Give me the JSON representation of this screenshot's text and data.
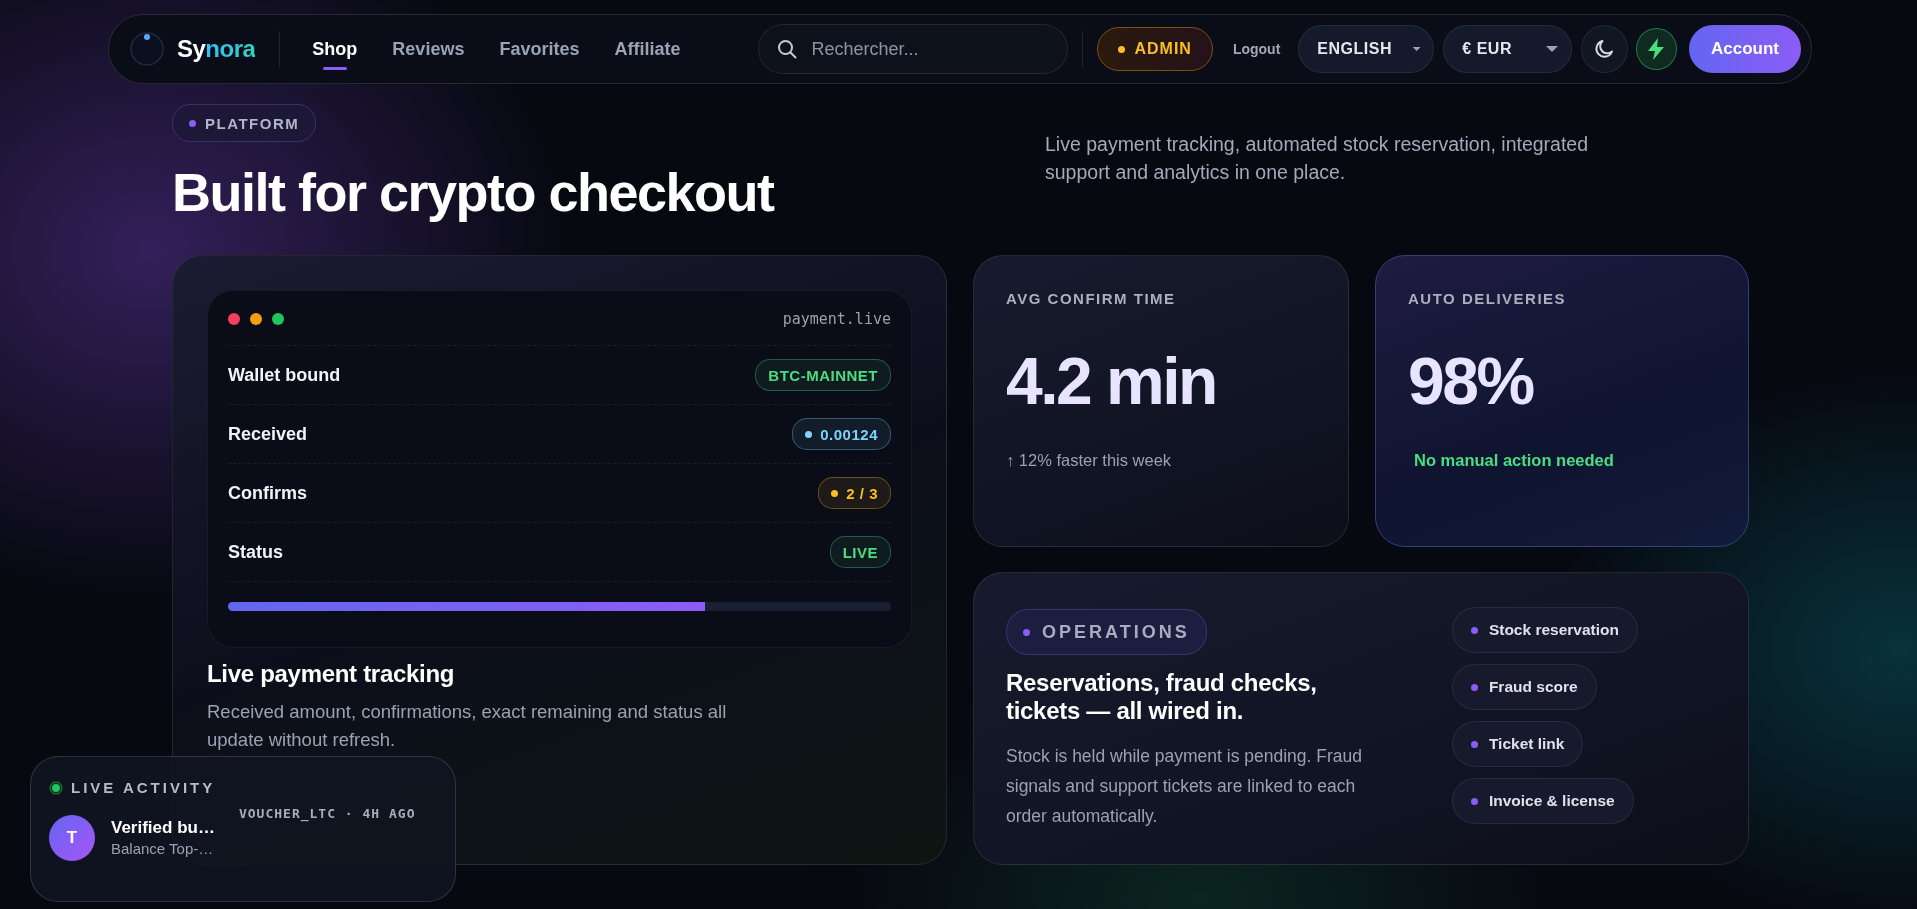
{
  "nav": {
    "logo": {
      "first": "Sy",
      "second": "nora"
    },
    "links": [
      {
        "label": "Shop",
        "selected": true
      },
      {
        "label": "Reviews",
        "selected": false
      },
      {
        "label": "Favorites",
        "selected": false
      },
      {
        "label": "Affiliate",
        "selected": false
      }
    ],
    "search": {
      "placeholder": "Rechercher..."
    },
    "admin_badge": "ADMIN",
    "logout": "Logout",
    "language": "ENGLISH",
    "currency": "€ EUR",
    "account": "Account"
  },
  "hero": {
    "badge": "PLATFORM",
    "title": "Built for crypto checkout",
    "description": "Live payment tracking, automated stock reservation, integrated support and analytics in one place."
  },
  "payment_card": {
    "window_title": "payment.live",
    "rows": [
      {
        "label": "Wallet bound",
        "value": "BTC-MAINNET",
        "color": "#4ade80",
        "dot": false
      },
      {
        "label": "Received",
        "value": "0.00124",
        "color": "#7dd3fc",
        "dot": true
      },
      {
        "label": "Confirms",
        "value": "2 / 3",
        "color": "#fbbf24",
        "dot": true
      },
      {
        "label": "Status",
        "value": "LIVE",
        "color": "#4ade80",
        "dot": false
      }
    ],
    "progress": {
      "level": 0.72
    },
    "title": "Live payment tracking",
    "description": "Received amount, confirmations, exact remaining and status all update without refresh."
  },
  "stats": [
    {
      "label": "AVG CONFIRM TIME",
      "value": "4.2 min",
      "note": "↑ 12% faster this week",
      "kind": "plain"
    },
    {
      "label": "AUTO DELIVERIES",
      "value": "98%",
      "note": "No manual action needed",
      "kind": "highlight"
    }
  ],
  "operations": {
    "badge": "OPERATIONS",
    "title": "Reservations, fraud checks, tickets — all wired in.",
    "description": "Stock is held while payment is pending. Fraud signals and support tickets are linked to each order automatically.",
    "features": [
      "Stock reservation",
      "Fraud score",
      "Ticket link",
      "Invoice & license"
    ]
  },
  "live_activity": {
    "title": "LIVE ACTIVITY",
    "avatar": "T",
    "name": "Verified bu…",
    "detail": "Balance Top-…",
    "meta": "VOUCHER_LTC · 4H AGO"
  }
}
